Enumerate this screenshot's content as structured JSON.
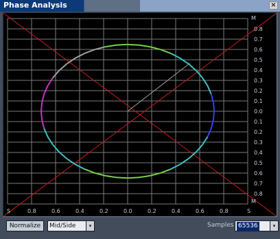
{
  "window": {
    "title": "Phase Analysis",
    "close_glyph": "×"
  },
  "scope": {
    "top_label": "M",
    "bottom_label": "M",
    "left_label": "S",
    "right_label": "S",
    "y_ticks": [
      "0.8",
      "0.7",
      "0.6",
      "0.5",
      "0.4",
      "0.3",
      "0.2",
      "0.1",
      "0.0",
      "0.1",
      "0.2",
      "0.3",
      "0.4",
      "0.5",
      "0.6",
      "0.7",
      "0.8"
    ],
    "x_ticks": [
      "0.8",
      "0.6",
      "0.4",
      "0.2",
      "0.0",
      "0.2",
      "0.4",
      "0.6",
      "0.8"
    ],
    "colors": {
      "background": "#000000",
      "grid": "#7b7b7b",
      "diagonals": "#c81e1e",
      "trace_colors": [
        "#3a3aff",
        "#c832c8",
        "#40c0c0",
        "#7ad04a",
        "#a0a0a0"
      ]
    }
  },
  "controls": {
    "normalize_label": "Normalize",
    "mode_value": "Mid/Side",
    "samples_label": "Samples",
    "samples_value": "65536",
    "dropdown_glyph": "▾"
  }
}
